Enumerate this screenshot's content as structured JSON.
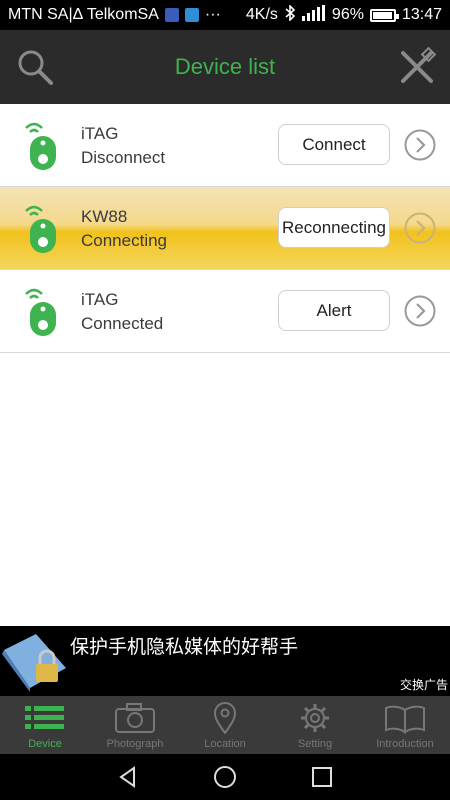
{
  "status_bar": {
    "carrier": "MTN SA|Δ TelkomSA",
    "more": "···",
    "speed": "4K/s",
    "battery": "96%",
    "time": "13:47"
  },
  "app_bar": {
    "title": "Device list",
    "left_icon": "search-icon",
    "right_icon": "tools-icon"
  },
  "devices": [
    {
      "name": "iTAG",
      "state": "Disconnect",
      "action": "Connect",
      "highlighted": false
    },
    {
      "name": "KW88",
      "state": "Connecting",
      "action": "Reconnecting",
      "highlighted": true
    },
    {
      "name": "iTAG",
      "state": "Connected",
      "action": "Alert",
      "highlighted": false
    }
  ],
  "ad": {
    "text": "保护手机隐私媒体的好帮手",
    "switch_label": "交换广告"
  },
  "tabs": [
    {
      "label": "Device",
      "icon": "list-icon",
      "active": true
    },
    {
      "label": "Photograph",
      "icon": "camera-icon",
      "active": false
    },
    {
      "label": "Location",
      "icon": "location-pin-icon",
      "active": false
    },
    {
      "label": "Setting",
      "icon": "gear-icon",
      "active": false
    },
    {
      "label": "Introduction",
      "icon": "book-icon",
      "active": false
    }
  ],
  "colors": {
    "accent": "#3fb34f",
    "app_bar": "#2b2b2b",
    "highlight": "#f2c21b",
    "tab_bar": "#3a3a3a"
  }
}
